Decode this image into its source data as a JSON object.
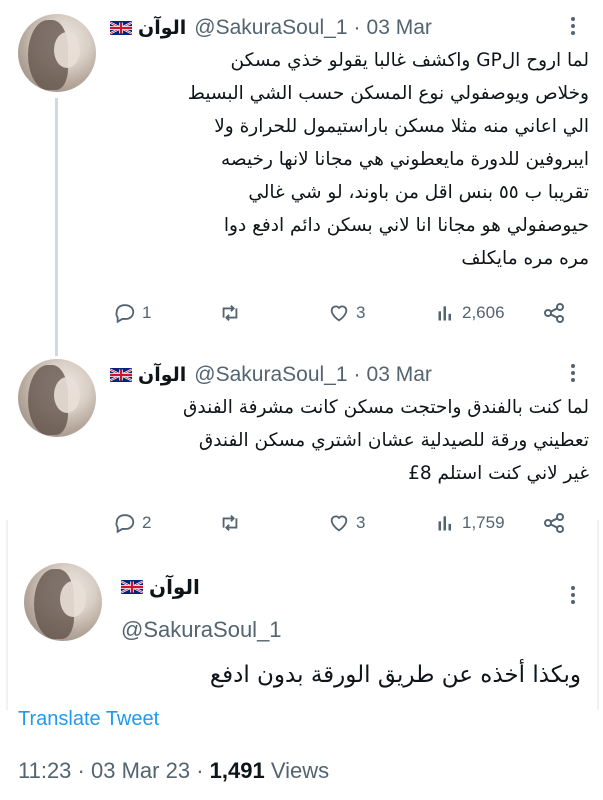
{
  "tweets": [
    {
      "display_name": "الوآن",
      "handle": "@SakuraSoul_1",
      "separator": "·",
      "date": "03 Mar",
      "text": "لما اروح الGP واكشف غالبا يقولو خذي مسكن\nوخلاص ويوصفولي نوع المسكن حسب الشي البسيط\nالي اعاني منه مثلا مسكن باراستيمول للحرارة ولا\nايبروفين للدورة مايعطوني هي مجانا لانها رخيصه\nتقريبا ب ٥٥ بنس اقل من باوند، لو شي غالي\nحيوصفولي هو مجانا انا لاني بسكن دائم ادفع دوا\nمره مره مايكلف",
      "replies": "1",
      "retweets": "",
      "likes": "3",
      "views": "2,606"
    },
    {
      "display_name": "الوآن",
      "handle": "@SakuraSoul_1",
      "separator": "·",
      "date": "03 Mar",
      "text": "لما كنت بالفندق واحتجت مسكن كانت مشرفة الفندق\nتعطيني ورقة للصيدلية عشان اشتري مسكن الفندق\nغير لاني كنت استلم 8£",
      "replies": "2",
      "retweets": "",
      "likes": "3",
      "views": "1,759"
    }
  ],
  "main_tweet": {
    "display_name": "الوآن",
    "handle": "@SakuraSoul_1",
    "text": "وبكذا أخذه عن طريق الورقة بدون ادفع",
    "translate_label": "Translate Tweet",
    "time": "11:23",
    "separator": "·",
    "date": "03 Mar 23",
    "views_count": "1,491",
    "views_label": "Views"
  },
  "icons": {
    "reply": "reply-icon",
    "retweet": "retweet-icon",
    "like": "heart-icon",
    "views": "views-icon",
    "share": "share-icon",
    "more": "more-icon",
    "flag": "uk-flag-icon"
  },
  "colors": {
    "text": "#0f1419",
    "secondary": "#536471",
    "accent": "#1d9bf0",
    "thread_line": "#cfd9de"
  }
}
